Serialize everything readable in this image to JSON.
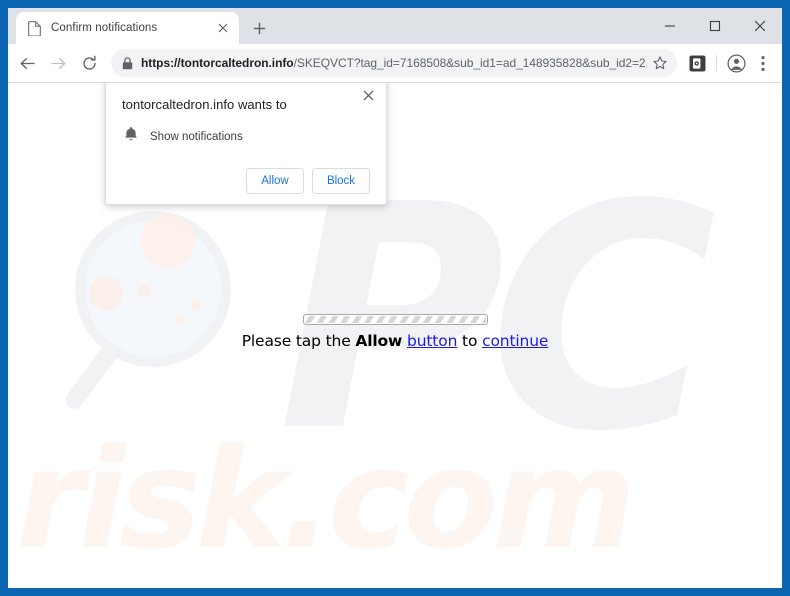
{
  "window": {
    "frame_color": "#0b65b2",
    "controls": {
      "minimize_label": "Minimize",
      "maximize_label": "Maximize",
      "close_label": "Close"
    }
  },
  "tab": {
    "title": "Confirm notifications",
    "favicon": "page-icon",
    "close_label": "Close tab",
    "new_tab_label": "New tab"
  },
  "toolbar": {
    "back_label": "Back",
    "forward_label": "Forward",
    "reload_label": "Reload",
    "lock_icon": "lock-icon",
    "url_host": "https://tontorcaltedron.info",
    "url_path": "/SKEQVCT?tag_id=7168508&sub_id1=ad_148935828&sub_id2=2...",
    "url_full": "https://tontorcaltedron.info/SKEQVCT?tag_id=7168508&sub_id1=ad_148935828&sub_id2=2...",
    "bookmark_label": "Bookmark this tab",
    "extension_label": "Extension",
    "profile_label": "Profile",
    "menu_label": "Customize and control Google Chrome"
  },
  "permission_bubble": {
    "title": "tontorcaltedron.info wants to",
    "option_icon": "bell-icon",
    "option_label": "Show notifications",
    "allow_label": "Allow",
    "block_label": "Block",
    "close_label": "Close",
    "accent_color": "#1a73e8"
  },
  "page": {
    "message_prefix": "Please tap the ",
    "message_bold": "Allow",
    "message_link1": "button",
    "message_middle": " to ",
    "message_link2": "continue",
    "progress_label": "Loading",
    "link_color": "#1a1ae8",
    "watermark_pc": "PC",
    "watermark_risk": "risk.com"
  }
}
